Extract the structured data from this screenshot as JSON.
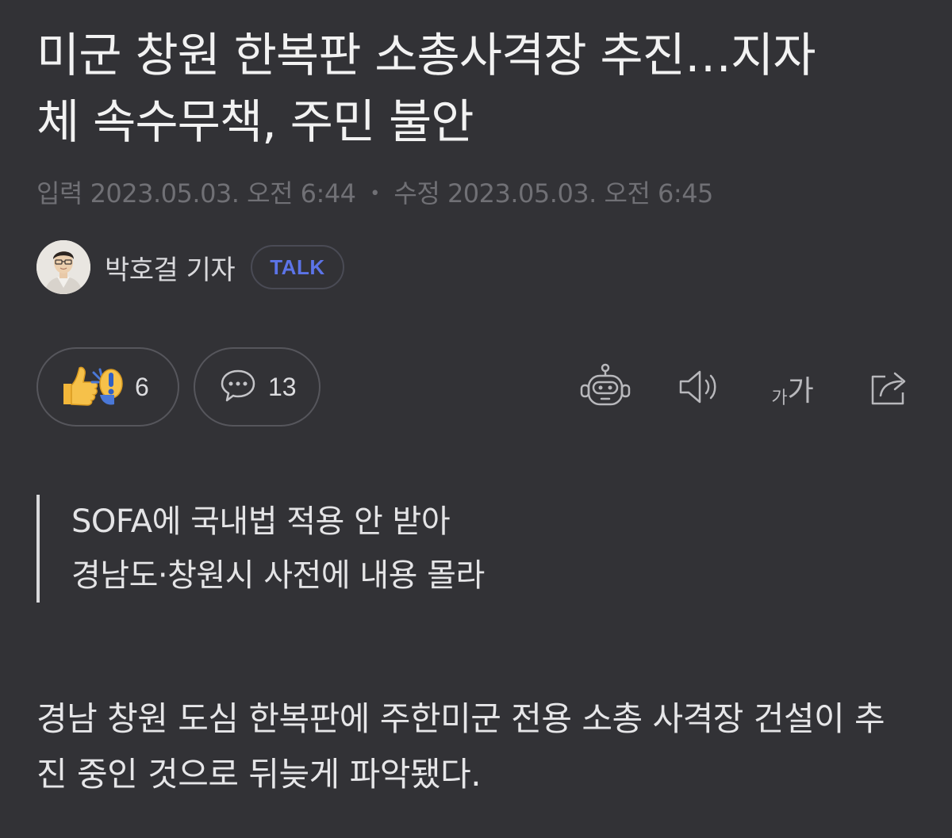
{
  "article": {
    "headline": "미군 창원 한복판 소총사격장 추진…지자체 속수무책, 주민 불안",
    "dates": {
      "input_label": "입력",
      "input_value": "2023.05.03. 오전 6:44",
      "separator": "•",
      "modified_label": "수정",
      "modified_value": "2023.05.03. 오전 6:45"
    },
    "byline": {
      "reporter": "박호걸 기자",
      "talk_label": "TALK"
    },
    "actions": {
      "reaction_count": "6",
      "comment_count": "13",
      "font_small": "가",
      "font_big": "가"
    },
    "subheadings": [
      "SOFA에 국내법 적용 안 받아",
      "경남도·창원시 사전에 내용 몰라"
    ],
    "body": "경남 창원 도심 한복판에 주한미군 전용 소총 사격장 건설이 추진 중인 것으로 뒤늦게 파악됐다."
  },
  "icons": {
    "reaction": "thumbs-up-surprise-icon",
    "comment": "speech-bubble-icon",
    "summary_bot": "robot-icon",
    "text_to_speech": "speaker-icon",
    "font_size": "font-size-icon",
    "share": "share-icon"
  },
  "colors": {
    "background": "#323236",
    "talk_accent": "#5c74e8",
    "meta_text": "#707075"
  }
}
